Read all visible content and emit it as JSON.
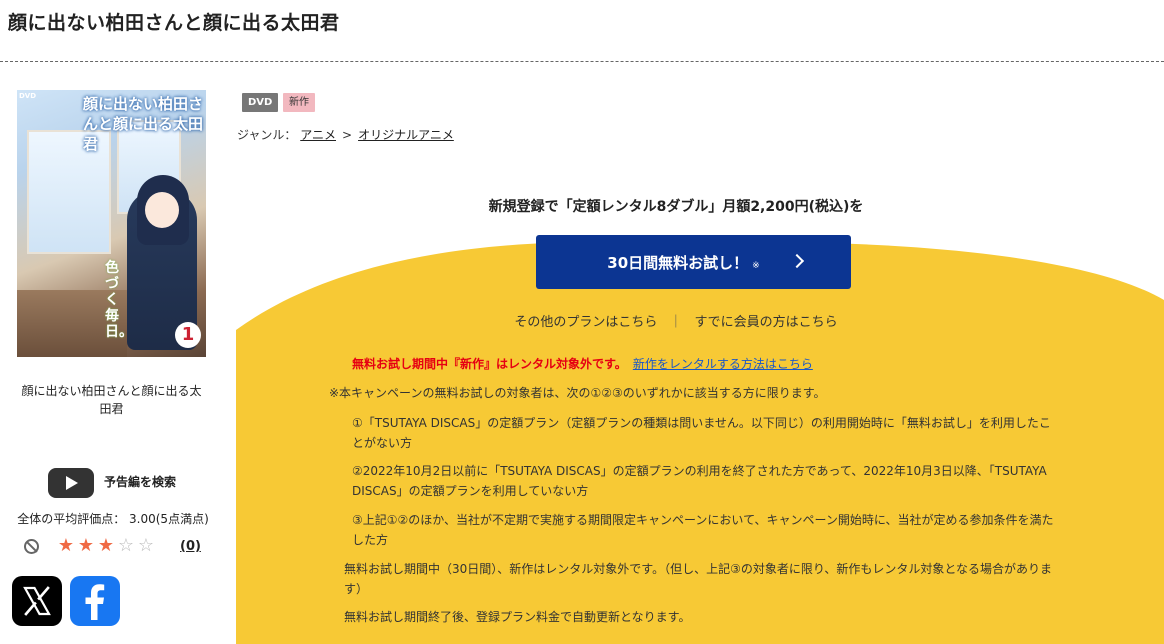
{
  "page": {
    "title": "顔に出ない柏田さんと顔に出る太田君"
  },
  "cover": {
    "title_text": "顔に出ない柏田さんと顔に出る太田君",
    "volume": "1",
    "tagline": "色づく毎日。",
    "badge": "DVD"
  },
  "sidebar": {
    "product_name": "顔に出ない柏田さんと顔に出る太田君",
    "trailer_label": "予告編を検索",
    "avg_rating_text": "全体の平均評価点： 3.00(5点満点)",
    "rating_stars": 3,
    "rating_max": 5,
    "review_count": "(0)",
    "sns": [
      "x-icon",
      "facebook-icon"
    ]
  },
  "item": {
    "badges": {
      "format": "DVD",
      "status": "新作"
    },
    "genre_label": "ジャンル：",
    "genre_path": [
      "アニメ",
      "オリジナルアニメ"
    ],
    "genre_separator": ">"
  },
  "promo": {
    "headline": "新規登録で「定額レンタル8ダブル」月額2,200円(税込)を",
    "cta_label": "30日間無料お試し！",
    "cta_note": "※",
    "other_plans": "その他のプランはこちら",
    "divider": "｜",
    "member_link": "すでに会員の方はこちら",
    "warning": "無料お試し期間中『新作』はレンタル対象外です。",
    "warning_link": "新作をレンタルする方法はこちら",
    "notes": [
      "※本キャンペーンの無料お試しの対象者は、次の①②③のいずれかに該当する方に限ります。",
      "①「TSUTAYA DISCAS」の定額プラン（定額プランの種類は問いません。以下同じ）の利用開始時に「無料お試し」を利用したことがない方",
      "②2022年10月2日以前に「TSUTAYA DISCAS」の定額プランの利用を終了された方であって、2022年10月3日以降、「TSUTAYA DISCAS」の定額プランを利用していない方",
      "③上記①②のほか、当社が不定期で実施する期間限定キャンペーンにおいて、キャンペーン開始時に、当社が定める参加条件を満たした方",
      "無料お試し期間中（30日間）、新作はレンタル対象外です。（但し、上記③の対象者に限り、新作もレンタル対象となる場合があります）",
      "無料お試し期間終了後、登録プラン料金で自動更新となります。"
    ],
    "accent_color": "#f7c935",
    "button_color": "#0c3592"
  }
}
